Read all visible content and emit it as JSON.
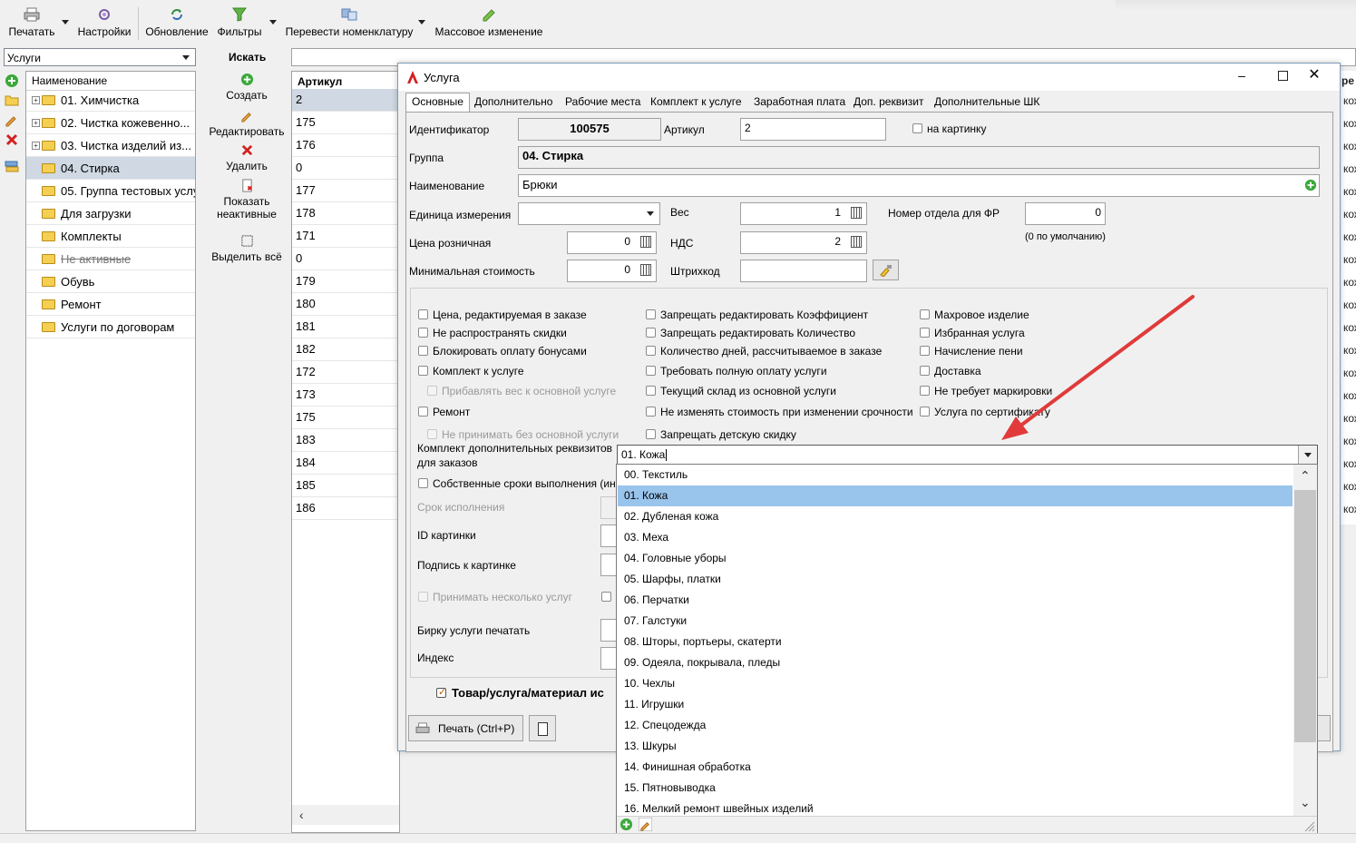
{
  "toolbar": {
    "print": "Печатать",
    "settings": "Настройки",
    "refresh": "Обновление",
    "filters": "Фильтры",
    "translate": "Перевести номенклатуру",
    "mass_edit": "Массовое изменение"
  },
  "category_combo": "Услуги",
  "search_label": "Искать",
  "tree": {
    "header": "Наименование",
    "items": [
      {
        "label": "01. Химчистка",
        "expandable": true
      },
      {
        "label": "02. Чистка кожевенно...",
        "expandable": true
      },
      {
        "label": "03. Чистка изделий из...",
        "expandable": true
      },
      {
        "label": "04. Стирка",
        "expandable": false,
        "selected": true
      },
      {
        "label": "05. Группа тестовых услу",
        "expandable": false
      },
      {
        "label": "Для загрузки",
        "expandable": false
      },
      {
        "label": "Комплекты",
        "expandable": false
      },
      {
        "label": "Не активные",
        "expandable": false,
        "strike": true
      },
      {
        "label": "Обувь",
        "expandable": false
      },
      {
        "label": "Ремонт",
        "expandable": false
      },
      {
        "label": "Услуги по договорам",
        "expandable": false
      }
    ]
  },
  "actions": {
    "create": "Создать",
    "edit": "Редактировать",
    "delete": "Удалить",
    "show_inactive_1": "Показать",
    "show_inactive_2": "неактивные",
    "select_all": "Выделить всё"
  },
  "grid": {
    "header": "Артикул",
    "rows": [
      "2",
      "175",
      "176",
      "0",
      "177",
      "178",
      "171",
      "0",
      "179",
      "180",
      "181",
      "182",
      "172",
      "173",
      "175",
      "183",
      "184",
      "185",
      "186"
    ]
  },
  "right_strip": {
    "header": "ре",
    "cells": [
      "кож",
      "кож",
      "кож",
      "кож",
      "кож",
      "кож",
      "кож",
      "кож",
      "кож",
      "кож",
      "кож",
      "кож",
      "кож",
      "кож",
      "кож",
      "кож",
      "кож",
      "кож",
      "кож"
    ]
  },
  "dialog": {
    "title": "Услуга",
    "tabs": [
      "Основные",
      "Дополнительно",
      "Рабочие места",
      "Комплект к услуге",
      "Заработная плата",
      "Доп. реквизит",
      "Дополнительные ШК"
    ],
    "identifier_label": "Идентификатор",
    "identifier": "100575",
    "article_label": "Артикул",
    "article": "2",
    "to_picture": "на картинку",
    "group_label": "Группа",
    "group": "04. Стирка",
    "name_label": "Наименование",
    "name": "Брюки",
    "unit_label": "Единица измерения",
    "unit": "",
    "weight_label": "Вес",
    "weight": "1",
    "dept_label": "Номер отдела для ФР",
    "dept": "0",
    "dept_hint": "(0 по умолчанию)",
    "retail_label": "Цена розничная",
    "retail": "0",
    "vat_label": "НДС",
    "vat": "2",
    "min_cost_label": "Минимальная стоимость",
    "min_cost": "0",
    "barcode_label": "Штрихкод",
    "barcode": "",
    "checks_col1": [
      {
        "label": "Цена, редактируемая в заказе",
        "disabled": false
      },
      {
        "label": "Не распространять скидки",
        "disabled": false
      },
      {
        "label": "Блокировать оплату бонусами",
        "disabled": false
      },
      {
        "label": "Комплект к услуге",
        "disabled": false
      },
      {
        "label": "Прибавлять вес к основной услуге",
        "disabled": true
      },
      {
        "label": "Ремонт",
        "disabled": false
      },
      {
        "label": "Не принимать без основной услуги",
        "disabled": true
      }
    ],
    "checks_col2": [
      "Запрещать редактировать Коэффициент",
      "Запрещать редактировать Количество",
      "Количество дней, рассчитываемое в заказе",
      "Требовать полную оплату услуги",
      "Текущий склад из основной услуги",
      "Не изменять стоимость при изменении срочности",
      "Запрещать детскую скидку"
    ],
    "checks_col3": [
      "Махровое изделие",
      "Избранная услуга",
      "Начисление пени",
      "Доставка",
      "Не требует маркировки",
      "Услуга по сертификату"
    ],
    "kit_label_1": "Комплект дополнительных реквизитов",
    "kit_label_2": "для заказов",
    "kit_value": "01. Кожа",
    "own_terms": "Собственные сроки выполнения (ин",
    "term_label": "Срок исполнения",
    "picture_id_label": "ID картинки",
    "picture_caption_label": "Подпись к картинке",
    "accept_multiple": "Принимать несколько услуг",
    "print_tag_label": "Бирку услуги печатать",
    "index_label": "Индекс",
    "goods_flag": "Товар/услуга/материал ис",
    "print_button": "Печать (Ctrl+P)"
  },
  "dropdown_items": [
    "00. Текстиль",
    "01. Кожа",
    "02. Дубленая кожа",
    "03. Меха",
    "04. Головные уборы",
    "05. Шарфы, платки",
    "06. Перчатки",
    "07. Галстуки",
    "08. Шторы, портьеры, скатерти",
    "09. Одеяла, покрывала, пледы",
    "10. Чехлы",
    "11. Игрушки",
    "12. Спецодежда",
    "13. Шкуры",
    "14. Финишная обработка",
    "15. Пятновыводка",
    "16. Мелкий ремонт швейных изделий"
  ],
  "dropdown_selected_index": 1,
  "colors": {
    "selection": "#99c4ec",
    "tree_selection": "#cfd8e3",
    "arrow": "#e03a3a",
    "accent_green": "#3aa83a"
  }
}
